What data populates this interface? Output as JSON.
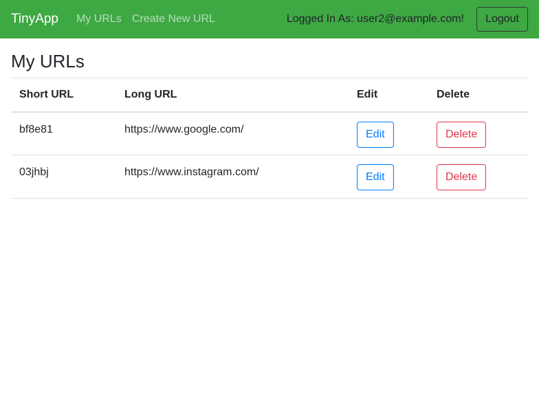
{
  "navbar": {
    "brand": "TinyApp",
    "links": [
      {
        "label": "My URLs"
      },
      {
        "label": "Create New URL"
      }
    ],
    "logged_in_text": "Logged In As: user2@example.com!",
    "logout_label": "Logout",
    "background_color": "#3ea843"
  },
  "main": {
    "title": "My URLs",
    "table": {
      "headers": [
        "Short URL",
        "Long URL",
        "Edit",
        "Delete"
      ],
      "rows": [
        {
          "short_url": "bf8e81",
          "long_url": "https://www.google.com/",
          "edit_label": "Edit",
          "delete_label": "Delete"
        },
        {
          "short_url": "03jhbj",
          "long_url": "https://www.instagram.com/",
          "edit_label": "Edit",
          "delete_label": "Delete"
        }
      ]
    }
  },
  "colors": {
    "edit_button": "#007bff",
    "delete_button": "#dc3545"
  }
}
